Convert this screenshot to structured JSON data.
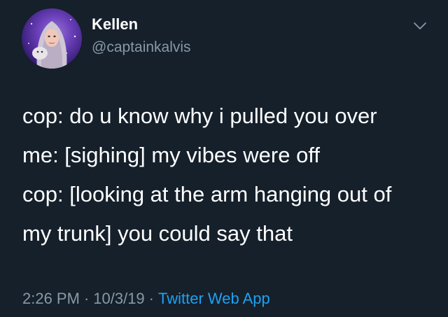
{
  "author": {
    "display_name": "Kellen",
    "handle": "@captainkalvis"
  },
  "tweet": {
    "lines": [
      "cop: do u know why i pulled you over",
      "me: [sighing] my vibes were off",
      "cop: [looking at the arm hanging out of",
      "my trunk] you could say that"
    ]
  },
  "meta": {
    "time": "2:26 PM",
    "separator": "·",
    "date": "10/3/19",
    "source": "Twitter Web App"
  },
  "icons": {
    "menu": "chevron-down-icon",
    "avatar": "avatar"
  },
  "colors": {
    "background": "#15202b",
    "text_primary": "#ffffff",
    "text_secondary": "#8899a6",
    "link": "#1da1f2"
  }
}
